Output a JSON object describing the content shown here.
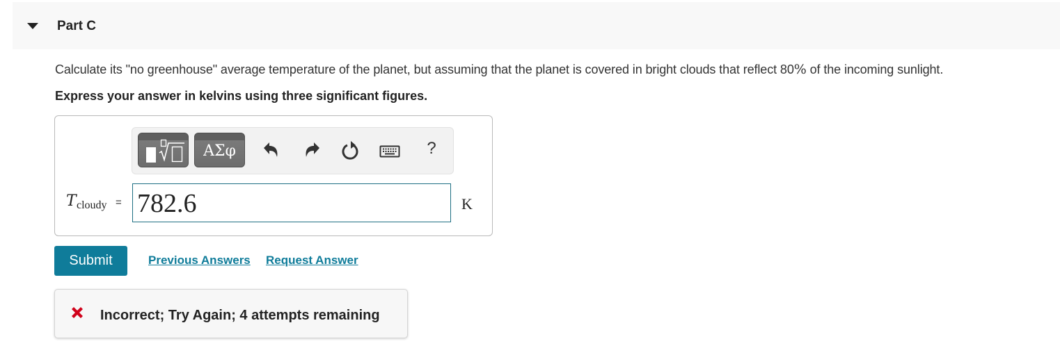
{
  "part": {
    "title": "Part C",
    "expanded": true
  },
  "question": {
    "text_before": "Calculate its \"no greenhouse\" average temperature of the planet, but assuming that the planet is covered in bright clouds that reflect 80",
    "percent_symbol": "%",
    "text_after": " of the incoming sunlight.",
    "instruction": "Express your answer in kelvins using three significant figures."
  },
  "toolbar": {
    "templates_button": "templates-icon",
    "symbols_label": "ΑΣφ",
    "undo": "undo-icon",
    "redo": "redo-icon",
    "reset": "reset-icon",
    "keyboard": "keyboard-icon",
    "help_label": "?"
  },
  "answer": {
    "variable": "T",
    "subscript": "cloudy",
    "equals": "=",
    "value": "782.6",
    "unit": "K"
  },
  "actions": {
    "submit_label": "Submit",
    "previous_answers_label": "Previous Answers",
    "request_answer_label": "Request Answer"
  },
  "feedback": {
    "status": "incorrect",
    "message": "Incorrect; Try Again; 4 attempts remaining",
    "icon_color": "#d0021b"
  },
  "colors": {
    "accent": "#0f7c9a",
    "input_border": "#1c6e82"
  }
}
